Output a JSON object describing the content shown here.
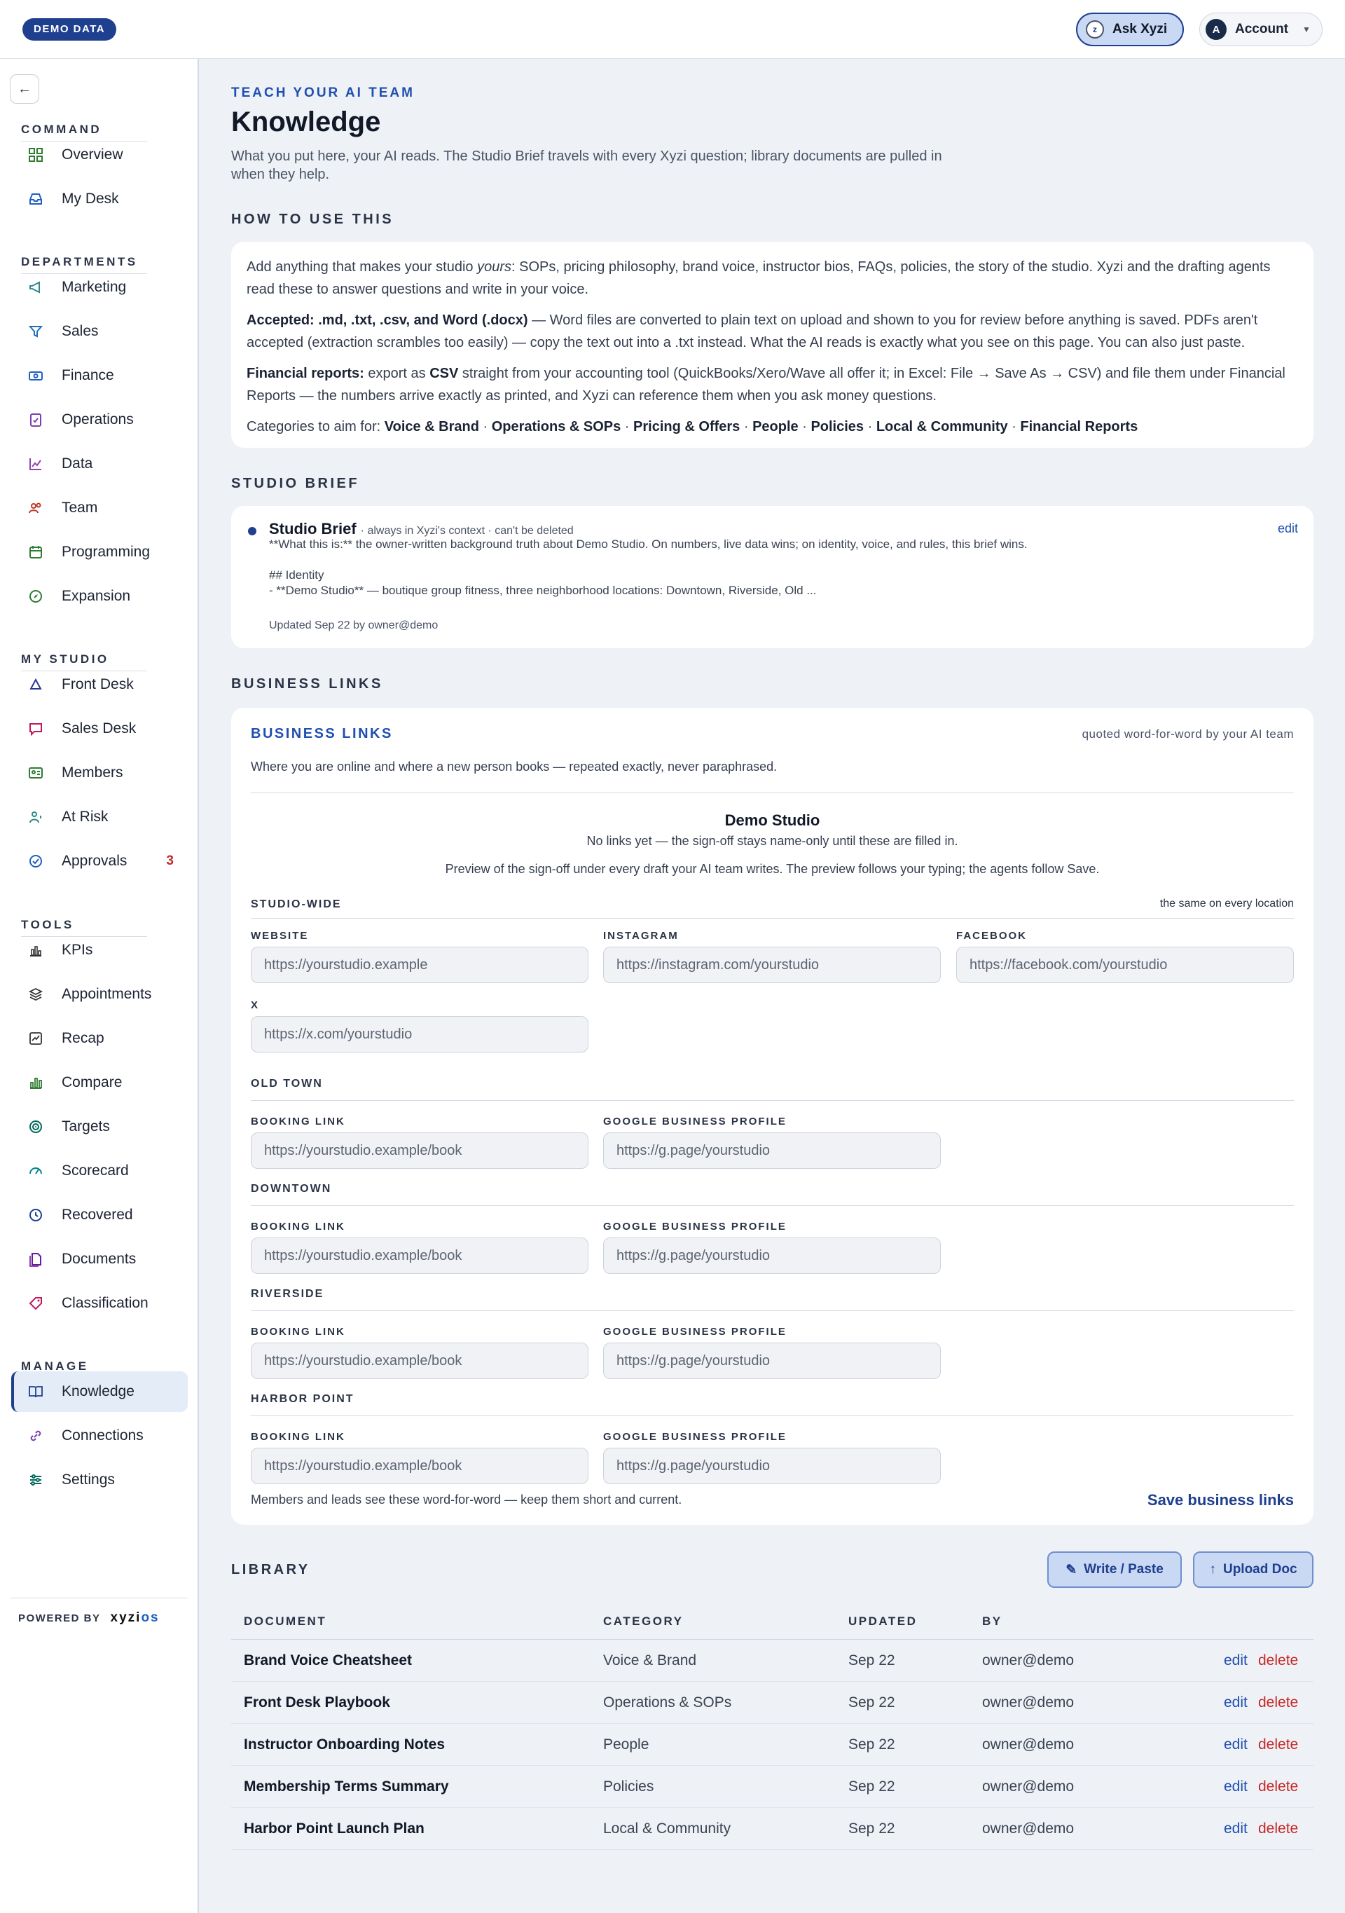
{
  "topbar": {
    "badge": "DEMO DATA",
    "ask_label": "Ask Xyzi",
    "ask_icon_glyph": "z",
    "account_label": "Account",
    "account_avatar": "A"
  },
  "sidebar": {
    "sections": {
      "command": "COMMAND",
      "departments": "DEPARTMENTS",
      "my_studio": "MY STUDIO",
      "tools": "TOOLS",
      "manage": "MANAGE"
    },
    "command": [
      {
        "label": "Overview",
        "icon": "grid-icon"
      },
      {
        "label": "My Desk",
        "icon": "inbox-icon"
      }
    ],
    "departments": [
      {
        "label": "Marketing",
        "icon": "megaphone-icon"
      },
      {
        "label": "Sales",
        "icon": "filter-icon"
      },
      {
        "label": "Finance",
        "icon": "banknote-icon"
      },
      {
        "label": "Operations",
        "icon": "clipboard-check-icon"
      },
      {
        "label": "Data",
        "icon": "line-chart-icon"
      },
      {
        "label": "Team",
        "icon": "users-icon"
      },
      {
        "label": "Programming",
        "icon": "calendar-icon"
      },
      {
        "label": "Expansion",
        "icon": "compass-icon"
      }
    ],
    "my_studio": [
      {
        "label": "Front Desk",
        "icon": "bell-icon"
      },
      {
        "label": "Sales Desk",
        "icon": "message-icon"
      },
      {
        "label": "Members",
        "icon": "id-card-icon"
      },
      {
        "label": "At Risk",
        "icon": "user-alert-icon"
      },
      {
        "label": "Approvals",
        "icon": "check-circle-icon",
        "badge": "3"
      }
    ],
    "tools": [
      {
        "label": "KPIs",
        "icon": "bar-chart-icon"
      },
      {
        "label": "Appointments",
        "icon": "layers-icon"
      },
      {
        "label": "Recap",
        "icon": "trend-icon"
      },
      {
        "label": "Compare",
        "icon": "columns-chart-icon"
      },
      {
        "label": "Targets",
        "icon": "target-icon"
      },
      {
        "label": "Scorecard",
        "icon": "gauge-icon"
      },
      {
        "label": "Recovered",
        "icon": "recovered-icon"
      },
      {
        "label": "Documents",
        "icon": "documents-icon"
      },
      {
        "label": "Classification",
        "icon": "tag-icon"
      }
    ],
    "manage": [
      {
        "label": "Knowledge",
        "icon": "book-icon",
        "active": true
      },
      {
        "label": "Connections",
        "icon": "link-icon"
      },
      {
        "label": "Settings",
        "icon": "sliders-icon"
      }
    ],
    "powered_by": "POWERED BY",
    "brand_a": "xyzi",
    "brand_b": "os"
  },
  "header": {
    "eyebrow": "TEACH YOUR AI TEAM",
    "title": "Knowledge",
    "subtitle": "What you put here, your AI reads. The Studio Brief travels with every Xyzi question; library documents are pulled in when they help."
  },
  "how_to": {
    "heading": "HOW TO USE THIS",
    "p1_a": "Add anything that makes your studio ",
    "p1_em": "yours",
    "p1_b": ": SOPs, pricing philosophy, brand voice, instructor bios, FAQs, policies, the story of the studio. Xyzi and the drafting agents read these to answer questions and write in your voice.",
    "p2_bold": "Accepted: .md, .txt, .csv, and Word (.docx)",
    "p2_rest": " — Word files are converted to plain text on upload and shown to you for review before anything is saved. PDFs aren't accepted (extraction scrambles too easily) — copy the text out into a .txt instead. What the AI reads is exactly what you see on this page. You can also just paste.",
    "p3_bold": "Financial reports:",
    "p3_a": " export as ",
    "p3_csv": "CSV",
    "p3_b": " straight from your accounting tool (QuickBooks/Xero/Wave all offer it; in Excel: File → Save As → CSV) and file them under Financial Reports — the numbers arrive exactly as printed, and Xyzi can reference them when you ask money questions.",
    "p4_lead": "Categories to aim for: ",
    "categories": [
      "Voice & Brand",
      "Operations & SOPs",
      "Pricing & Offers",
      "People",
      "Policies",
      "Local & Community",
      "Financial Reports"
    ],
    "sep": " · "
  },
  "studio_brief": {
    "heading": "STUDIO BRIEF",
    "title": "Studio Brief",
    "meta": "· always in Xyzi's context · can't be deleted",
    "edit": "edit",
    "body": "**What this is:** the owner-written background truth about Demo Studio. On numbers, live data wins; on identity, voice, and rules, this brief wins.\n\n## Identity\n- **Demo Studio** — boutique group fitness, three neighborhood locations: Downtown, Riverside, Old ...",
    "updated": "Updated Sep 22 by owner@demo"
  },
  "business_links": {
    "heading": "BUSINESS LINKS",
    "card_title": "BUSINESS LINKS",
    "note": "quoted word-for-word by your AI team",
    "description": "Where you are online and where a new person books — repeated exactly, never paraphrased.",
    "preview_name": "Demo Studio",
    "preview_status": "No links yet — the sign-off stays name-only until these are filled in.",
    "preview_caption": "Preview of the sign-off under every draft your AI team writes. The preview follows your typing; the agents follow Save.",
    "studio_wide": {
      "label": "STUDIO-WIDE",
      "note": "the same on every location",
      "website_label": "WEBSITE",
      "website_placeholder": "https://yourstudio.example",
      "instagram_label": "INSTAGRAM",
      "instagram_placeholder": "https://instagram.com/yourstudio",
      "facebook_label": "FACEBOOK",
      "facebook_placeholder": "https://facebook.com/yourstudio",
      "x_label": "X",
      "x_placeholder": "https://x.com/yourstudio"
    },
    "booking_label": "BOOKING LINK",
    "gbp_label": "GOOGLE BUSINESS PROFILE",
    "booking_placeholder": "https://yourstudio.example/book",
    "gbp_placeholder": "https://g.page/yourstudio",
    "locations": [
      "OLD TOWN",
      "DOWNTOWN",
      "RIVERSIDE",
      "HARBOR POINT"
    ],
    "footer": "Members and leads see these word-for-word — keep them short and current.",
    "save": "Save business links"
  },
  "library": {
    "heading": "LIBRARY",
    "write_btn": "Write / Paste",
    "upload_btn": "Upload Doc",
    "columns": [
      "DOCUMENT",
      "CATEGORY",
      "UPDATED",
      "BY"
    ],
    "edit": "edit",
    "delete": "delete",
    "rows": [
      {
        "doc": "Brand Voice Cheatsheet",
        "category": "Voice & Brand",
        "updated": "Sep 22",
        "by": "owner@demo"
      },
      {
        "doc": "Front Desk Playbook",
        "category": "Operations & SOPs",
        "updated": "Sep 22",
        "by": "owner@demo"
      },
      {
        "doc": "Instructor Onboarding Notes",
        "category": "People",
        "updated": "Sep 22",
        "by": "owner@demo"
      },
      {
        "doc": "Membership Terms Summary",
        "category": "Policies",
        "updated": "Sep 22",
        "by": "owner@demo"
      },
      {
        "doc": "Harbor Point Launch Plan",
        "category": "Local & Community",
        "updated": "Sep 22",
        "by": "owner@demo"
      }
    ]
  },
  "colors": {
    "accent": "#1f3f8f",
    "link": "#1f4fb0",
    "danger": "#c62828"
  }
}
